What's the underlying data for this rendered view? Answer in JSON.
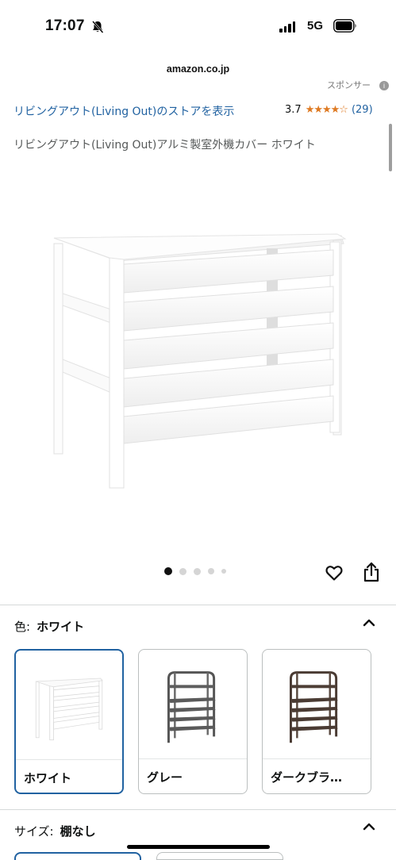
{
  "status": {
    "time": "17:07",
    "network": "5G"
  },
  "browser": {
    "url": "amazon.co.jp"
  },
  "sponsored": {
    "label": "スポンサー",
    "info_icon": "info-icon"
  },
  "product": {
    "store_link": "リビングアウト(Living Out)のストアを表示",
    "rating": "3.7",
    "stars": "★★★★☆",
    "review_count": "(29)",
    "title": "リビングアウト(Living Out)アルミ製室外機カバー ホワイト"
  },
  "gallery": {
    "image_count": 5,
    "active_index": 0
  },
  "color_section": {
    "label": "色:",
    "selected": "ホワイト",
    "options": [
      {
        "label": "ホワイト",
        "color": "#ffffff",
        "selected": true
      },
      {
        "label": "グレー",
        "color": "#5a5a5a",
        "selected": false
      },
      {
        "label": "ダークブラ…",
        "color": "#4a3b33",
        "selected": false
      }
    ]
  },
  "size_section": {
    "label": "サイズ:",
    "selected": "棚なし"
  },
  "colors": {
    "link": "#2162a1",
    "star": "#de7921",
    "selected_border": "#2162a1"
  }
}
